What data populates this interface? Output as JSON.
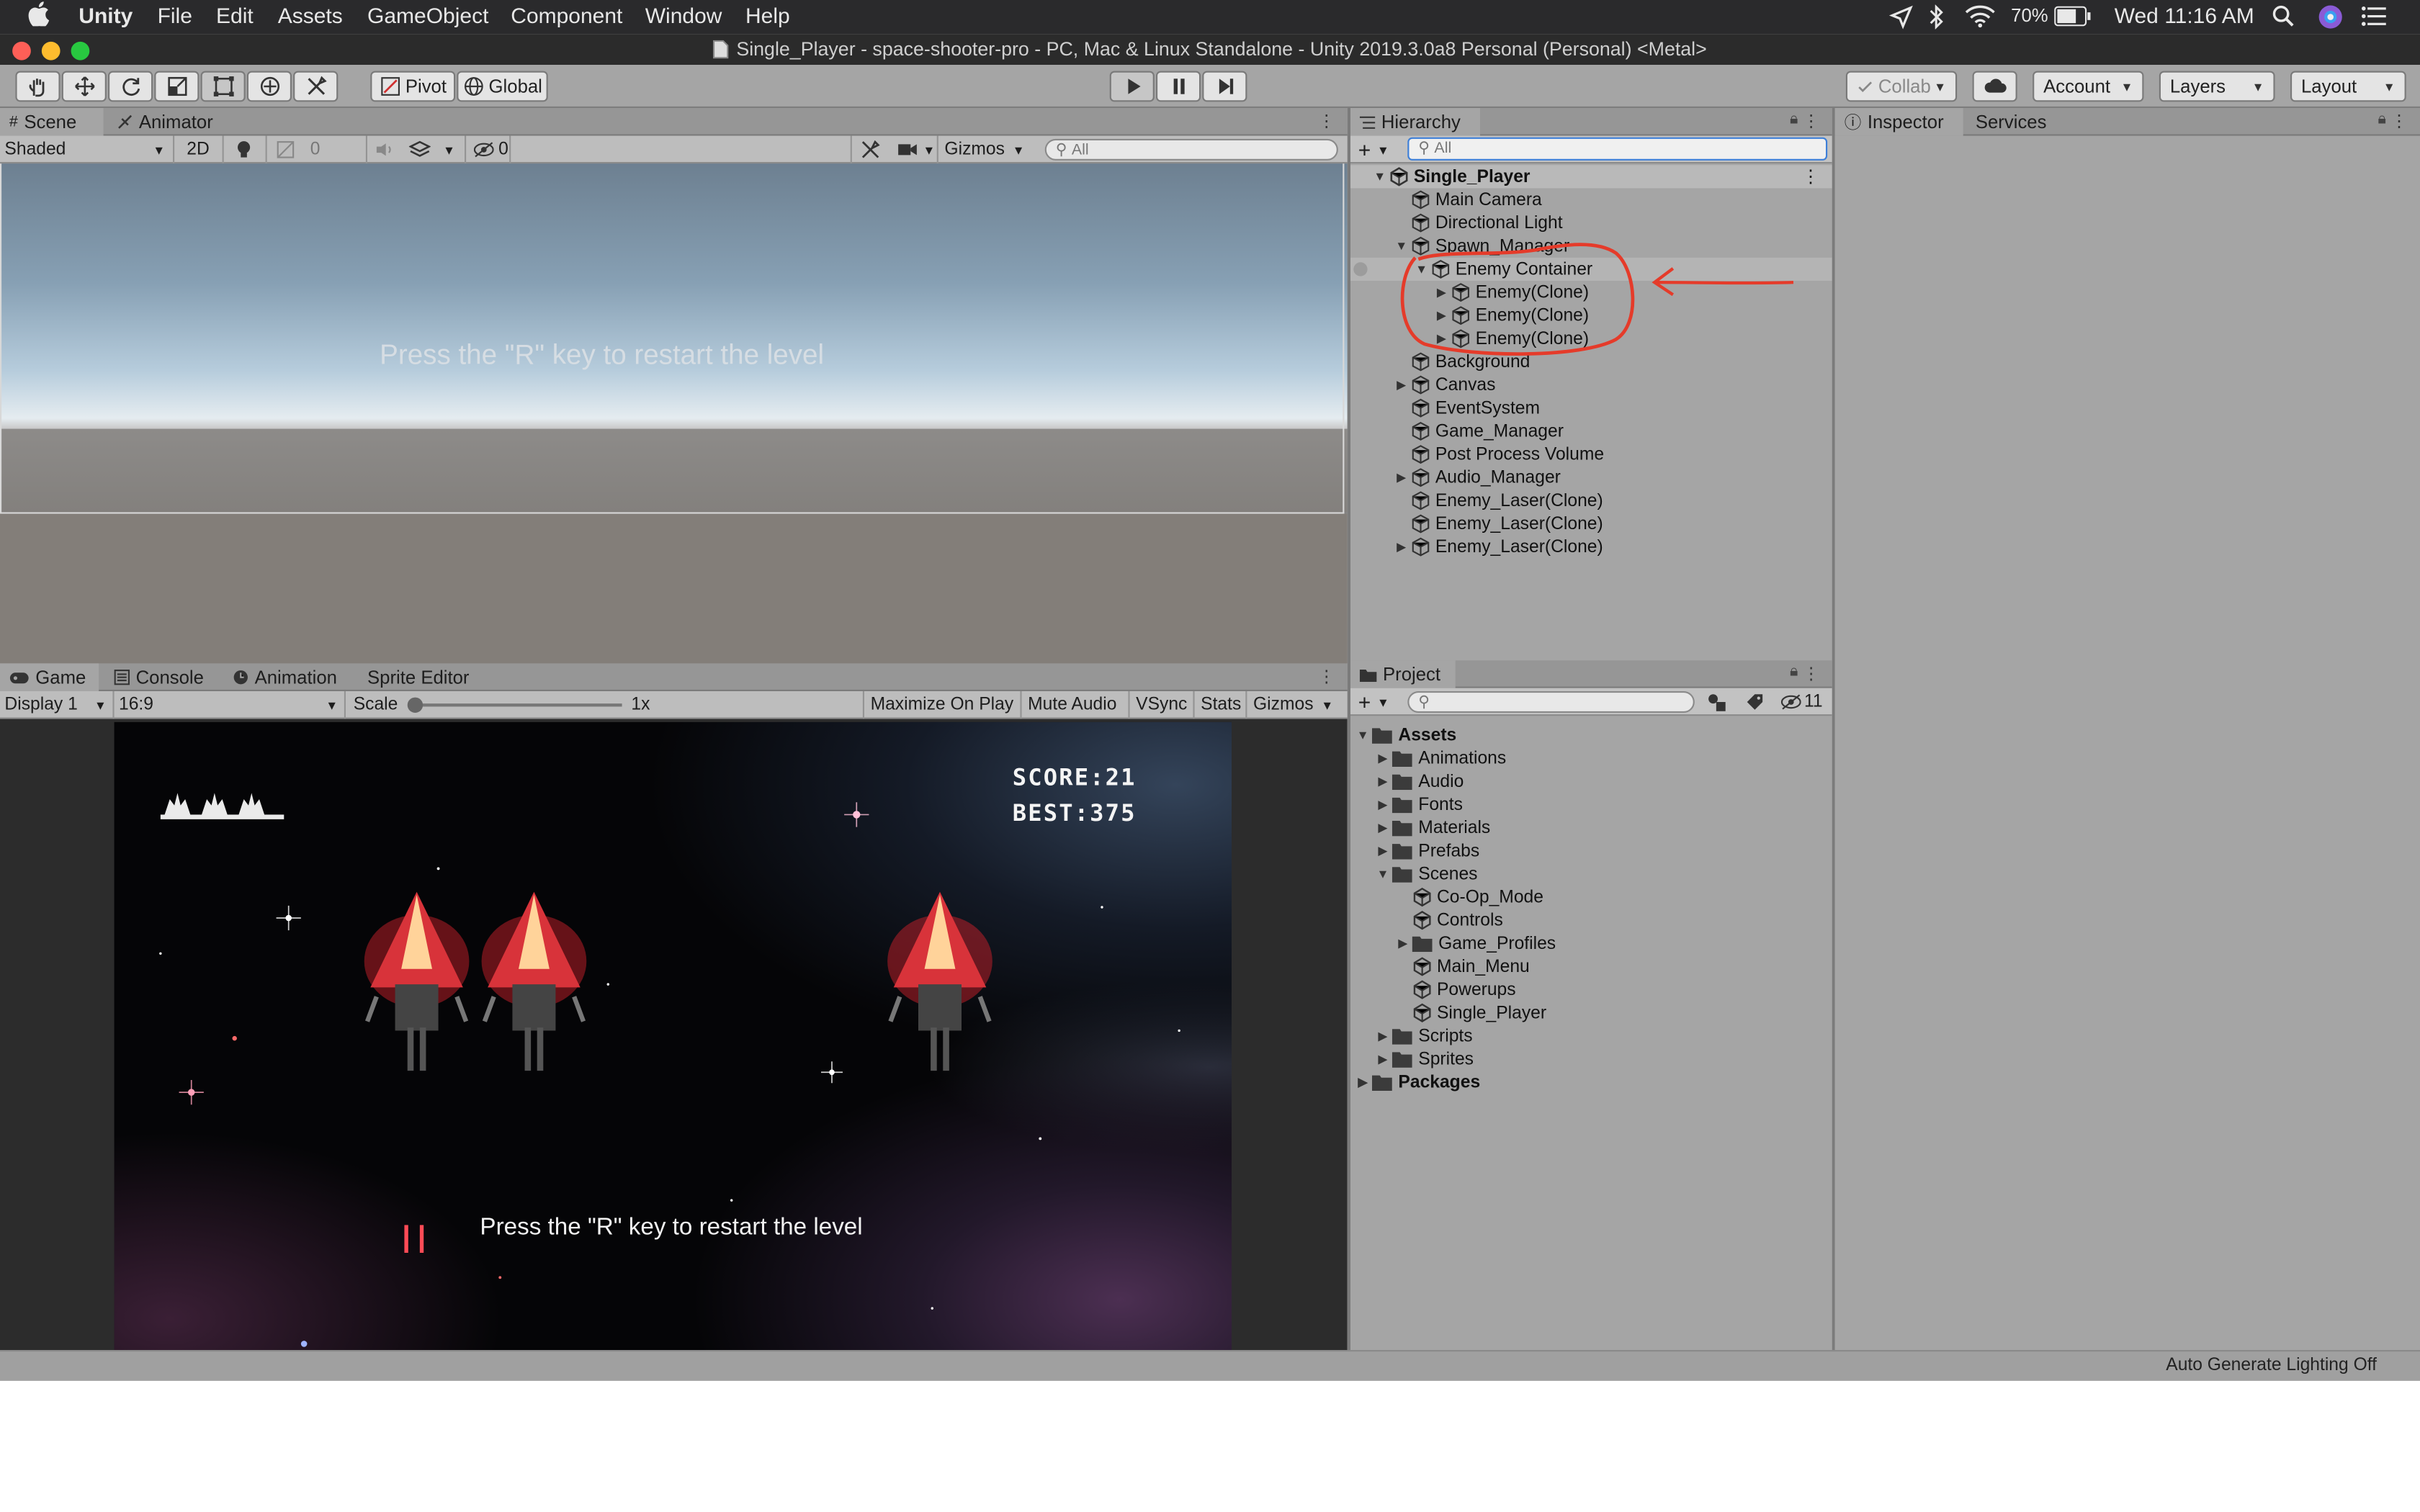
{
  "menubar": {
    "app": "Unity",
    "items": [
      "File",
      "Edit",
      "Assets",
      "GameObject",
      "Component",
      "Window",
      "Help"
    ],
    "battery": "70%",
    "clock": "Wed 11:16 AM"
  },
  "window": {
    "title": "Single_Player - space-shooter-pro - PC, Mac & Linux Standalone - Unity 2019.3.0a8 Personal (Personal) <Metal>"
  },
  "toolbar": {
    "pivot": "Pivot",
    "global": "Global",
    "collab": "Collab",
    "account": "Account",
    "layers": "Layers",
    "layout": "Layout"
  },
  "scene": {
    "tabs": [
      "Scene",
      "Animator"
    ],
    "shading": "Shaded",
    "mode2d": "2D",
    "fx_count": "0",
    "hidden_count": "0",
    "gizmos": "Gizmos",
    "search_placeholder": "All",
    "overlay_text": "Press the \"R\" key to restart the level"
  },
  "game": {
    "tabs": [
      "Game",
      "Console",
      "Animation",
      "Sprite Editor"
    ],
    "display": "Display 1",
    "aspect": "16:9",
    "scale_label": "Scale",
    "scale_value": "1x",
    "buttons": [
      "Maximize On Play",
      "Mute Audio",
      "VSync",
      "Stats",
      "Gizmos"
    ],
    "score": "SCORE:21",
    "best": "BEST:375",
    "restart_text": "Press the \"R\" key to restart the level"
  },
  "hierarchy": {
    "tab": "Hierarchy",
    "search_placeholder": "All",
    "scene_name": "Single_Player",
    "items": [
      {
        "label": "Main Camera"
      },
      {
        "label": "Directional Light"
      },
      {
        "label": "Spawn_Manager"
      },
      {
        "label": "Enemy Container"
      },
      {
        "label": "Enemy(Clone)"
      },
      {
        "label": "Enemy(Clone)"
      },
      {
        "label": "Enemy(Clone)"
      },
      {
        "label": "Background"
      },
      {
        "label": "Canvas"
      },
      {
        "label": "EventSystem"
      },
      {
        "label": "Game_Manager"
      },
      {
        "label": "Post Process Volume"
      },
      {
        "label": "Audio_Manager"
      },
      {
        "label": "Enemy_Laser(Clone)"
      },
      {
        "label": "Enemy_Laser(Clone)"
      },
      {
        "label": "Enemy_Laser(Clone)"
      }
    ],
    "annotation_color": "#e53b2a"
  },
  "inspector": {
    "tabs": [
      "Inspector",
      "Services"
    ]
  },
  "project": {
    "tab": "Project",
    "hidden_count": "11",
    "items": [
      {
        "label": "Assets"
      },
      {
        "label": "Animations"
      },
      {
        "label": "Audio"
      },
      {
        "label": "Fonts"
      },
      {
        "label": "Materials"
      },
      {
        "label": "Prefabs"
      },
      {
        "label": "Scenes"
      },
      {
        "label": "Co-Op_Mode"
      },
      {
        "label": "Controls"
      },
      {
        "label": "Game_Profiles"
      },
      {
        "label": "Main_Menu"
      },
      {
        "label": "Powerups"
      },
      {
        "label": "Single_Player"
      },
      {
        "label": "Scripts"
      },
      {
        "label": "Sprites"
      },
      {
        "label": "Packages"
      }
    ]
  },
  "statusbar": {
    "lighting": "Auto Generate Lighting Off"
  }
}
